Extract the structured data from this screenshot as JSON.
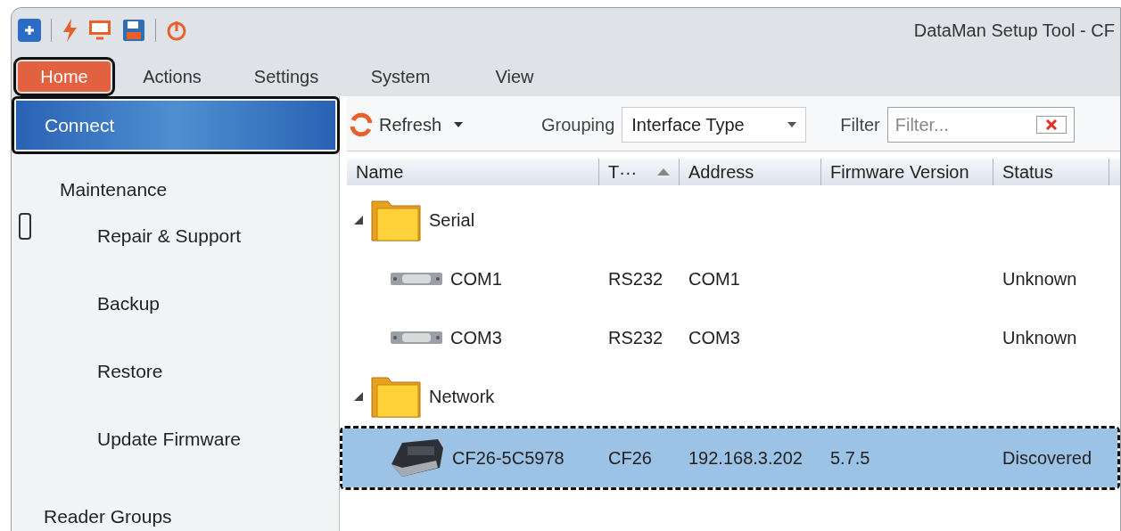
{
  "window": {
    "title": "DataMan Setup Tool - CF"
  },
  "tabs": [
    {
      "label": "Home",
      "selected": true,
      "outlined": true
    },
    {
      "label": "Actions",
      "selected": false,
      "outlined": false
    },
    {
      "label": "Settings",
      "selected": false,
      "outlined": false
    },
    {
      "label": "System",
      "selected": false,
      "outlined": false
    },
    {
      "label": "View",
      "selected": false,
      "outlined": false
    }
  ],
  "sidebar": {
    "items": [
      {
        "label": "Connect",
        "selected": true,
        "outlined": true
      },
      {
        "label": "Maintenance",
        "selected": false,
        "outlined": false,
        "children": [
          {
            "label": "Repair & Support",
            "selected": false
          },
          {
            "label": "Backup",
            "selected": false
          },
          {
            "label": "Restore",
            "selected": false
          },
          {
            "label": "Update Firmware",
            "selected": false
          }
        ]
      },
      {
        "label": "Reader Groups",
        "selected": false,
        "outlined": false
      }
    ]
  },
  "toolbar": {
    "refresh": "Refresh",
    "grouping_label": "Grouping",
    "grouping_value": "Interface Type",
    "filter_label": "Filter",
    "filter": {
      "placeholder": "Filter..."
    }
  },
  "table": {
    "columns": [
      {
        "label": "Name",
        "sorted": false
      },
      {
        "label": "T···",
        "sorted": true
      },
      {
        "label": "Address",
        "sorted": false
      },
      {
        "label": "Firmware Version",
        "sorted": false
      },
      {
        "label": "Status",
        "sorted": false
      }
    ],
    "groups": [
      {
        "label": "Serial",
        "expanded": true,
        "children": [
          {
            "kind": "serial",
            "cells": [
              "COM1",
              "RS232",
              "COM1",
              "",
              "Unknown"
            ],
            "selected": false,
            "outlined": false
          },
          {
            "kind": "serial",
            "cells": [
              "COM3",
              "RS232",
              "COM3",
              "",
              "Unknown"
            ],
            "selected": false,
            "outlined": false
          }
        ]
      },
      {
        "label": "Network",
        "expanded": true,
        "children": [
          {
            "kind": "reader",
            "cells": [
              "CF26-5C5978",
              "CF26",
              "192.168.3.202",
              "5.7.5",
              "Discovered"
            ],
            "selected": true,
            "outlined": true
          }
        ]
      }
    ]
  }
}
